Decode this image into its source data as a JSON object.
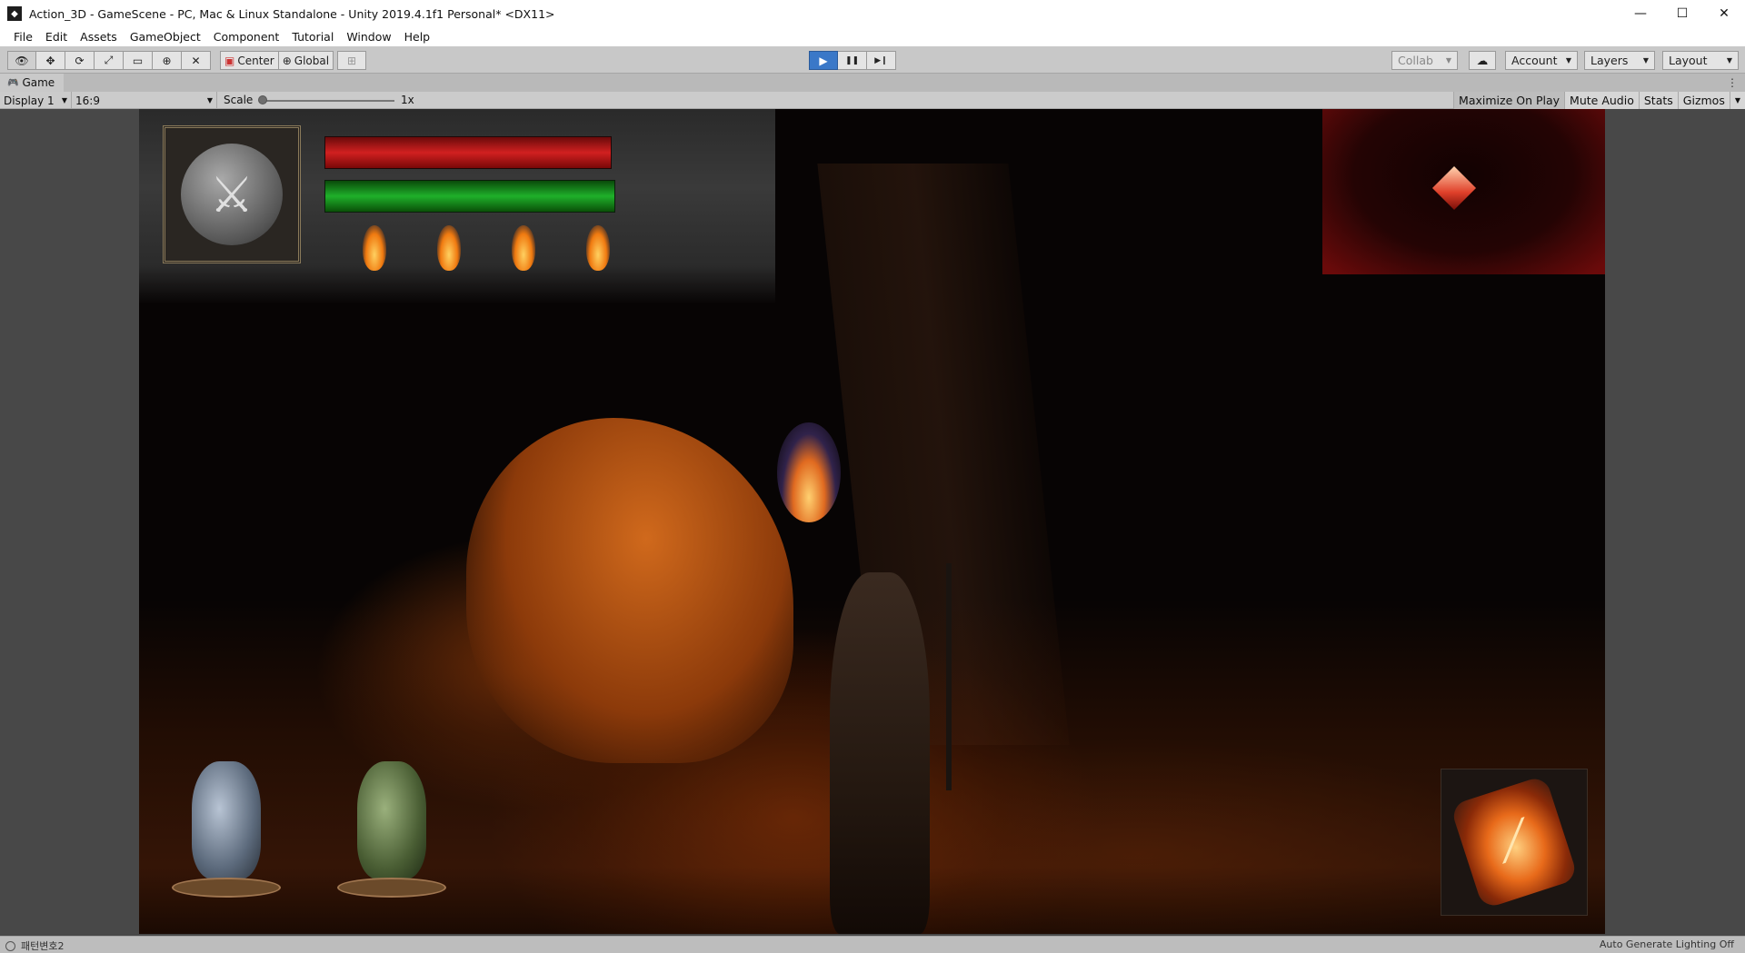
{
  "window": {
    "title": "Action_3D - GameScene - PC, Mac & Linux Standalone - Unity 2019.4.1f1 Personal* <DX11>",
    "app_icon": "unity-icon",
    "minimize": "—",
    "maximize": "☐",
    "close": "✕"
  },
  "menu": [
    "File",
    "Edit",
    "Assets",
    "GameObject",
    "Component",
    "Tutorial",
    "Window",
    "Help"
  ],
  "toolbar": {
    "tools": [
      "view-tool-icon",
      "move-tool-icon",
      "rotate-tool-icon",
      "scale-tool-icon",
      "rect-tool-icon",
      "transform-tool-icon",
      "custom-tool-icon"
    ],
    "pivot_mode": "Center",
    "pivot_rotation": "Global",
    "play": "▶",
    "pause": "❚❚",
    "step": "▶❙",
    "collab": "Collab",
    "account": "Account",
    "layers": "Layers",
    "layout": "Layout"
  },
  "game_tab": {
    "label": "Game",
    "display": "Display 1",
    "aspect": "16:9",
    "scale_label": "Scale",
    "scale_value": "1x",
    "scale_level": 0,
    "maximize_on_play": "Maximize On Play",
    "mute_audio": "Mute Audio",
    "stats": "Stats",
    "gizmos": "Gizmos"
  },
  "hud": {
    "health_level": 1.0,
    "stamina_level": 1.0,
    "flame_count": 4
  },
  "status": {
    "message": "패턴변호2",
    "lighting": "Auto Generate Lighting Off"
  },
  "colors": {
    "play_button": "#3a78c8",
    "health": "#d12020",
    "stamina": "#1fb02a"
  }
}
